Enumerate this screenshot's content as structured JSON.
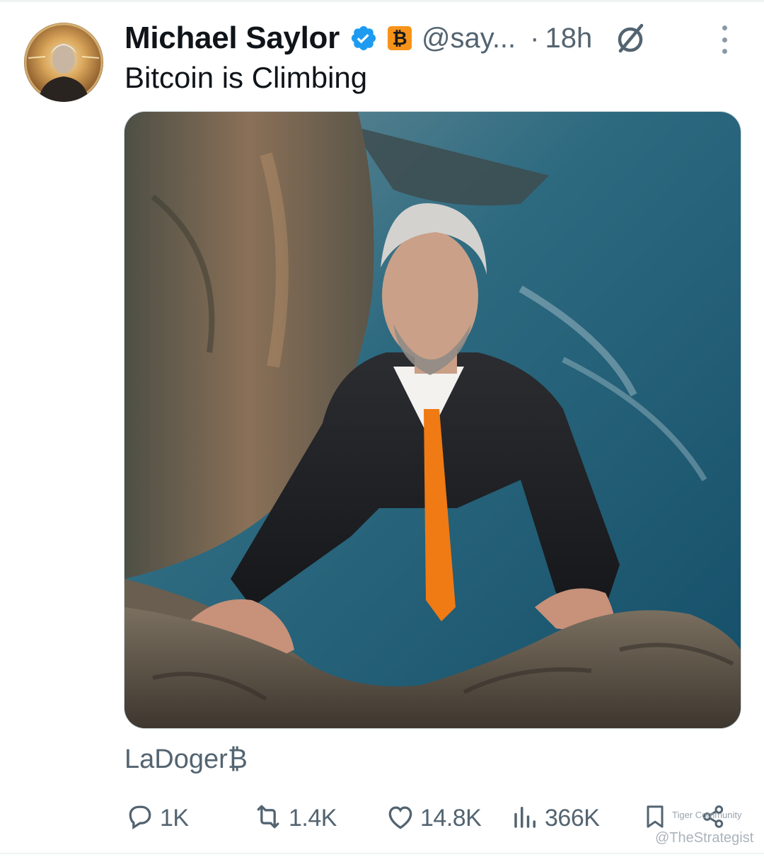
{
  "author": {
    "name": "Michael Saylor",
    "badge_symbol": "₿",
    "handle": "@say...",
    "separator": "·",
    "time": "18h"
  },
  "tweet": {
    "text": "Bitcoin is Climbing",
    "image_alt": "Gray-haired man in a dark suit and orange tie climbing over a rocky cliff edge above the sea",
    "caption": "LaDoger₿"
  },
  "actions": {
    "replies": "1K",
    "reposts": "1.4K",
    "likes": "14.8K",
    "views": "366K"
  },
  "watermark": {
    "label": "Tiger Community",
    "handle": "@TheStrategist"
  },
  "colors": {
    "verified": "#1d9bf0",
    "bitcoin_orange": "#f7931a",
    "secondary_text": "#536471",
    "tie_orange": "#f07a14"
  },
  "icons": [
    "verified-badge-icon",
    "bitcoin-badge-icon",
    "grok-icon",
    "more-icon",
    "reply-icon",
    "repost-icon",
    "like-icon",
    "views-icon",
    "bookmark-icon",
    "share-icon"
  ]
}
